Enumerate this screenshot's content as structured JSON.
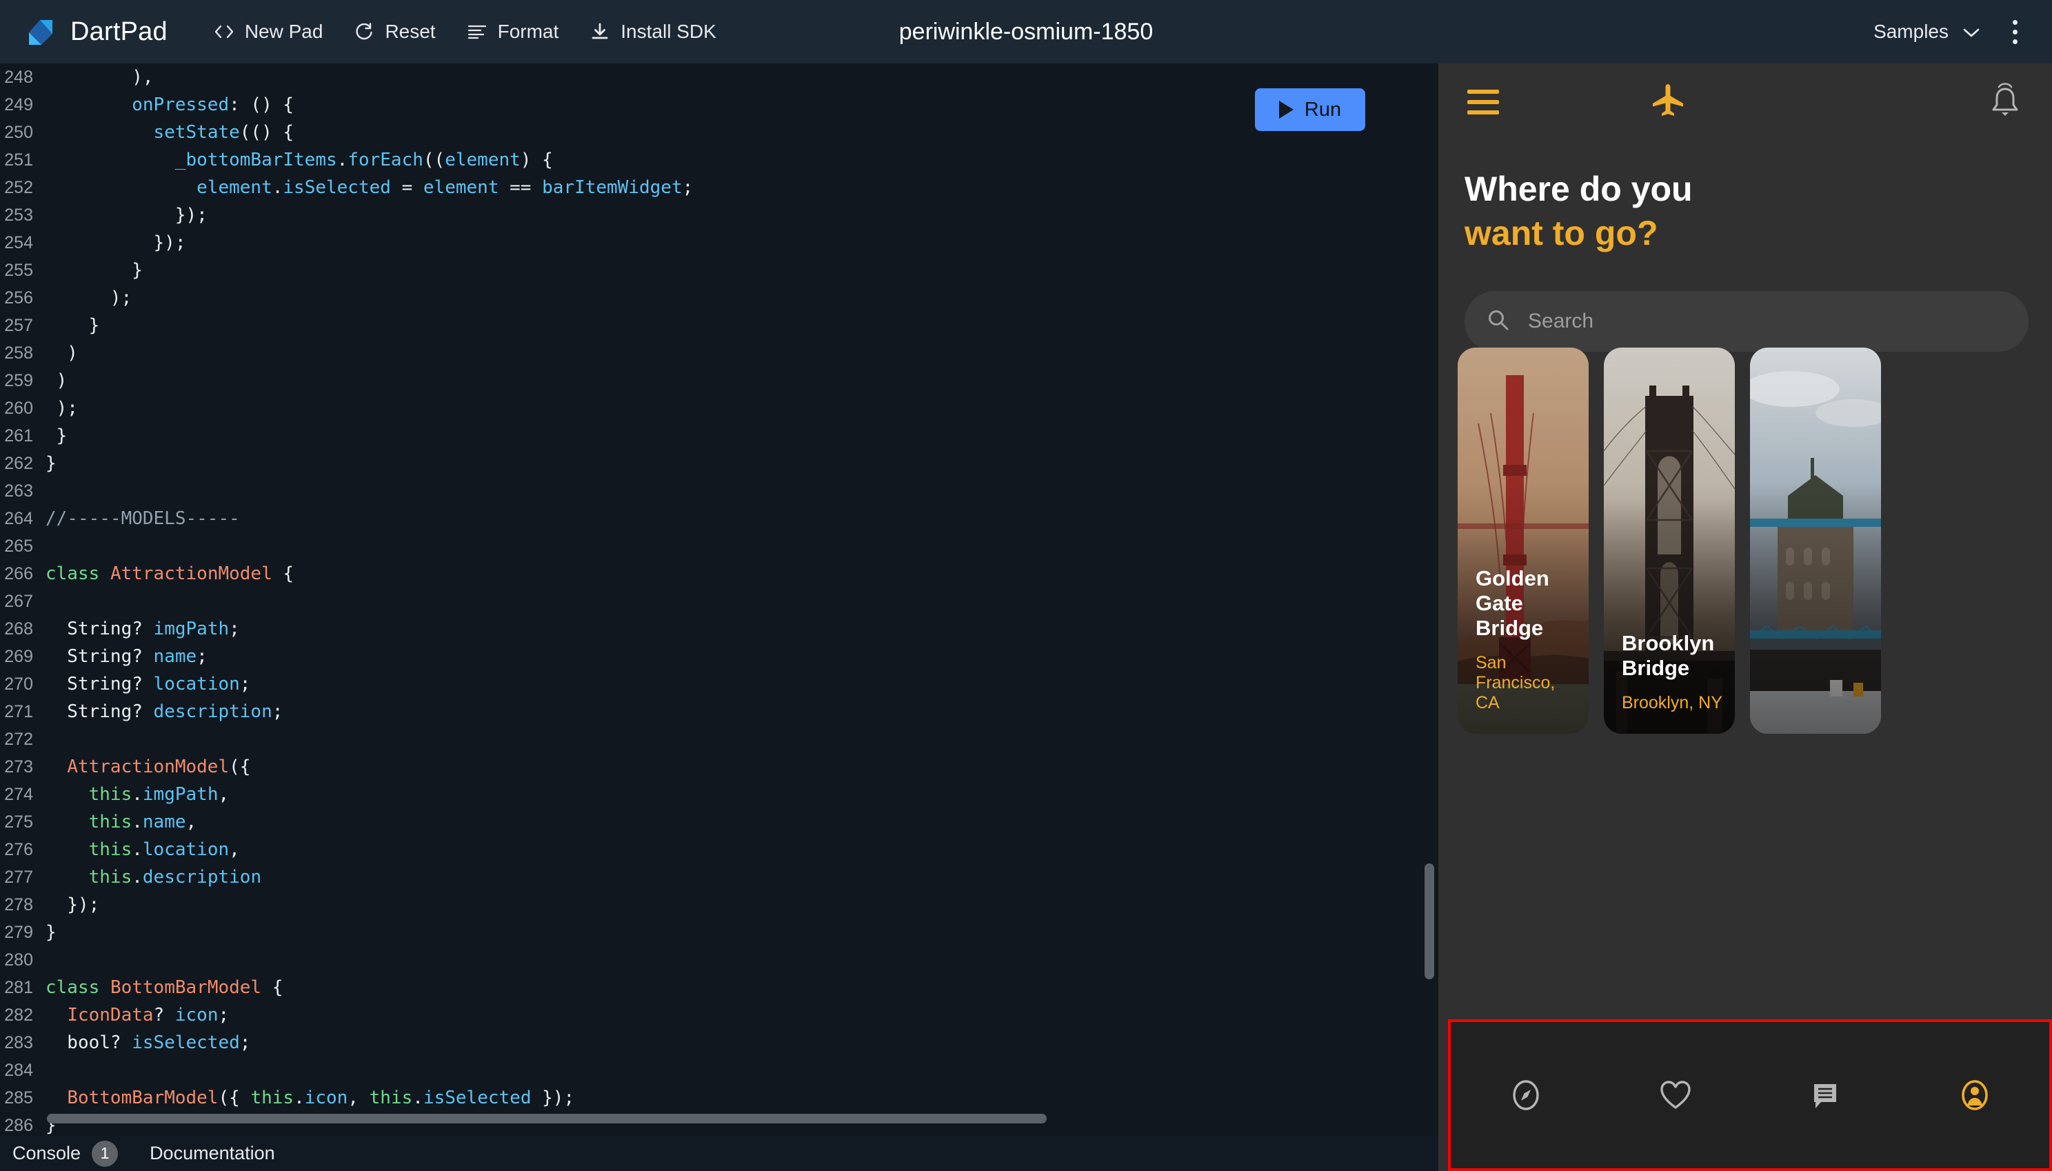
{
  "topbar": {
    "brand": "DartPad",
    "actions": [
      {
        "label": "New Pad",
        "icon": "code-brackets-icon"
      },
      {
        "label": "Reset",
        "icon": "refresh-icon"
      },
      {
        "label": "Format",
        "icon": "format-align-icon"
      },
      {
        "label": "Install SDK",
        "icon": "download-icon"
      }
    ],
    "title": "periwinkle-osmium-1850",
    "samples_label": "Samples",
    "samples_icon": "chevron-down-icon",
    "more_icon": "kebab-menu-icon"
  },
  "editor": {
    "run_label": "Run",
    "run_icon": "play-triangle-icon",
    "lines": [
      {
        "n": "248",
        "tokens": [
          {
            "t": "        ),",
            "c": "plain"
          }
        ]
      },
      {
        "n": "249",
        "tokens": [
          {
            "t": "        ",
            "c": "plain"
          },
          {
            "t": "onPressed",
            "c": "id"
          },
          {
            "t": ": () {",
            "c": "plain"
          }
        ]
      },
      {
        "n": "250",
        "tokens": [
          {
            "t": "          ",
            "c": "plain"
          },
          {
            "t": "setState",
            "c": "id"
          },
          {
            "t": "(() {",
            "c": "plain"
          }
        ]
      },
      {
        "n": "251",
        "tokens": [
          {
            "t": "            ",
            "c": "plain"
          },
          {
            "t": "_bottomBarItems",
            "c": "id"
          },
          {
            "t": ".",
            "c": "plain"
          },
          {
            "t": "forEach",
            "c": "id"
          },
          {
            "t": "((",
            "c": "plain"
          },
          {
            "t": "element",
            "c": "id"
          },
          {
            "t": ") {",
            "c": "plain"
          }
        ]
      },
      {
        "n": "252",
        "tokens": [
          {
            "t": "              ",
            "c": "plain"
          },
          {
            "t": "element",
            "c": "id"
          },
          {
            "t": ".",
            "c": "plain"
          },
          {
            "t": "isSelected",
            "c": "id"
          },
          {
            "t": " = ",
            "c": "plain"
          },
          {
            "t": "element",
            "c": "id"
          },
          {
            "t": " == ",
            "c": "plain"
          },
          {
            "t": "barItemWidget",
            "c": "id"
          },
          {
            "t": ";",
            "c": "plain"
          }
        ]
      },
      {
        "n": "253",
        "tokens": [
          {
            "t": "            });",
            "c": "plain"
          }
        ]
      },
      {
        "n": "254",
        "tokens": [
          {
            "t": "          });",
            "c": "plain"
          }
        ]
      },
      {
        "n": "255",
        "tokens": [
          {
            "t": "        }",
            "c": "plain"
          }
        ]
      },
      {
        "n": "256",
        "tokens": [
          {
            "t": "      );",
            "c": "plain"
          }
        ]
      },
      {
        "n": "257",
        "tokens": [
          {
            "t": "    }",
            "c": "plain"
          }
        ]
      },
      {
        "n": "258",
        "tokens": [
          {
            "t": "  )",
            "c": "plain"
          }
        ]
      },
      {
        "n": "259",
        "tokens": [
          {
            "t": " )",
            "c": "plain"
          }
        ]
      },
      {
        "n": "260",
        "tokens": [
          {
            "t": " );",
            "c": "plain"
          }
        ]
      },
      {
        "n": "261",
        "tokens": [
          {
            "t": " }",
            "c": "plain"
          }
        ]
      },
      {
        "n": "262",
        "tokens": [
          {
            "t": "}",
            "c": "plain"
          }
        ]
      },
      {
        "n": "263",
        "tokens": [
          {
            "t": "",
            "c": "plain"
          }
        ]
      },
      {
        "n": "264",
        "tokens": [
          {
            "t": "//-----MODELS-----",
            "c": "cmt"
          }
        ]
      },
      {
        "n": "265",
        "tokens": [
          {
            "t": "",
            "c": "plain"
          }
        ]
      },
      {
        "n": "266",
        "tokens": [
          {
            "t": "class",
            "c": "kw"
          },
          {
            "t": " ",
            "c": "plain"
          },
          {
            "t": "AttractionModel",
            "c": "type"
          },
          {
            "t": " {",
            "c": "plain"
          }
        ]
      },
      {
        "n": "267",
        "tokens": [
          {
            "t": "",
            "c": "plain"
          }
        ]
      },
      {
        "n": "268",
        "tokens": [
          {
            "t": "  String? ",
            "c": "plain"
          },
          {
            "t": "imgPath",
            "c": "id"
          },
          {
            "t": ";",
            "c": "plain"
          }
        ]
      },
      {
        "n": "269",
        "tokens": [
          {
            "t": "  String? ",
            "c": "plain"
          },
          {
            "t": "name",
            "c": "id"
          },
          {
            "t": ";",
            "c": "plain"
          }
        ]
      },
      {
        "n": "270",
        "tokens": [
          {
            "t": "  String? ",
            "c": "plain"
          },
          {
            "t": "location",
            "c": "id"
          },
          {
            "t": ";",
            "c": "plain"
          }
        ]
      },
      {
        "n": "271",
        "tokens": [
          {
            "t": "  String? ",
            "c": "plain"
          },
          {
            "t": "description",
            "c": "id"
          },
          {
            "t": ";",
            "c": "plain"
          }
        ]
      },
      {
        "n": "272",
        "tokens": [
          {
            "t": "",
            "c": "plain"
          }
        ]
      },
      {
        "n": "273",
        "tokens": [
          {
            "t": "  ",
            "c": "plain"
          },
          {
            "t": "AttractionModel",
            "c": "type"
          },
          {
            "t": "({",
            "c": "plain"
          }
        ]
      },
      {
        "n": "274",
        "tokens": [
          {
            "t": "    ",
            "c": "plain"
          },
          {
            "t": "this",
            "c": "kw"
          },
          {
            "t": ".",
            "c": "plain"
          },
          {
            "t": "imgPath",
            "c": "id"
          },
          {
            "t": ",",
            "c": "plain"
          }
        ]
      },
      {
        "n": "275",
        "tokens": [
          {
            "t": "    ",
            "c": "plain"
          },
          {
            "t": "this",
            "c": "kw"
          },
          {
            "t": ".",
            "c": "plain"
          },
          {
            "t": "name",
            "c": "id"
          },
          {
            "t": ",",
            "c": "plain"
          }
        ]
      },
      {
        "n": "276",
        "tokens": [
          {
            "t": "    ",
            "c": "plain"
          },
          {
            "t": "this",
            "c": "kw"
          },
          {
            "t": ".",
            "c": "plain"
          },
          {
            "t": "location",
            "c": "id"
          },
          {
            "t": ",",
            "c": "plain"
          }
        ]
      },
      {
        "n": "277",
        "tokens": [
          {
            "t": "    ",
            "c": "plain"
          },
          {
            "t": "this",
            "c": "kw"
          },
          {
            "t": ".",
            "c": "plain"
          },
          {
            "t": "description",
            "c": "id"
          }
        ]
      },
      {
        "n": "278",
        "tokens": [
          {
            "t": "  });",
            "c": "plain"
          }
        ]
      },
      {
        "n": "279",
        "tokens": [
          {
            "t": "}",
            "c": "plain"
          }
        ]
      },
      {
        "n": "280",
        "tokens": [
          {
            "t": "",
            "c": "plain"
          }
        ]
      },
      {
        "n": "281",
        "tokens": [
          {
            "t": "class",
            "c": "kw"
          },
          {
            "t": " ",
            "c": "plain"
          },
          {
            "t": "BottomBarModel",
            "c": "type"
          },
          {
            "t": " {",
            "c": "plain"
          }
        ]
      },
      {
        "n": "282",
        "tokens": [
          {
            "t": "  ",
            "c": "plain"
          },
          {
            "t": "IconData",
            "c": "type"
          },
          {
            "t": "? ",
            "c": "plain"
          },
          {
            "t": "icon",
            "c": "id"
          },
          {
            "t": ";",
            "c": "plain"
          }
        ]
      },
      {
        "n": "283",
        "tokens": [
          {
            "t": "  bool? ",
            "c": "plain"
          },
          {
            "t": "isSelected",
            "c": "id"
          },
          {
            "t": ";",
            "c": "plain"
          }
        ]
      },
      {
        "n": "284",
        "tokens": [
          {
            "t": "",
            "c": "plain"
          }
        ]
      },
      {
        "n": "285",
        "tokens": [
          {
            "t": "  ",
            "c": "plain"
          },
          {
            "t": "BottomBarModel",
            "c": "type"
          },
          {
            "t": "({ ",
            "c": "plain"
          },
          {
            "t": "this",
            "c": "kw"
          },
          {
            "t": ".",
            "c": "plain"
          },
          {
            "t": "icon",
            "c": "id"
          },
          {
            "t": ", ",
            "c": "plain"
          },
          {
            "t": "this",
            "c": "kw"
          },
          {
            "t": ".",
            "c": "plain"
          },
          {
            "t": "isSelected",
            "c": "id"
          },
          {
            "t": " });",
            "c": "plain"
          }
        ]
      },
      {
        "n": "286",
        "tokens": [
          {
            "t": "}",
            "c": "plain"
          }
        ]
      }
    ]
  },
  "statusbar": {
    "console_label": "Console",
    "console_badge": "1",
    "documentation_label": "Documentation"
  },
  "preview": {
    "appbar": {
      "menu_icon": "hamburger-menu-icon",
      "brand_icon": "airplane-icon",
      "notification_icon": "bell-icon"
    },
    "headline_line1": "Where do you",
    "headline_line2": "want to go?",
    "search": {
      "icon": "search-icon",
      "placeholder": "Search",
      "value": ""
    },
    "cards": [
      {
        "name": "Golden Gate\nBridge",
        "location": "San Francisco, CA",
        "image": "golden-gate-bridge-photo"
      },
      {
        "name": "Brooklyn\nBridge",
        "location": "Brooklyn, NY",
        "image": "brooklyn-bridge-photo"
      },
      {
        "name": "",
        "location": "",
        "image": "tower-bridge-photo"
      }
    ],
    "bottom_nav": [
      {
        "icon": "explore-compass-icon",
        "selected": false
      },
      {
        "icon": "heart-favorite-icon",
        "selected": false
      },
      {
        "icon": "chat-message-icon",
        "selected": false
      },
      {
        "icon": "account-circle-icon",
        "selected": true
      }
    ]
  },
  "colors": {
    "accent_amber": "#f0ad2b",
    "run_blue": "#4d8dfc",
    "highlight_red": "#ff0000",
    "panel_bg": "#303030",
    "editor_bg": "#10171f",
    "topbar_bg": "#1c2834"
  }
}
